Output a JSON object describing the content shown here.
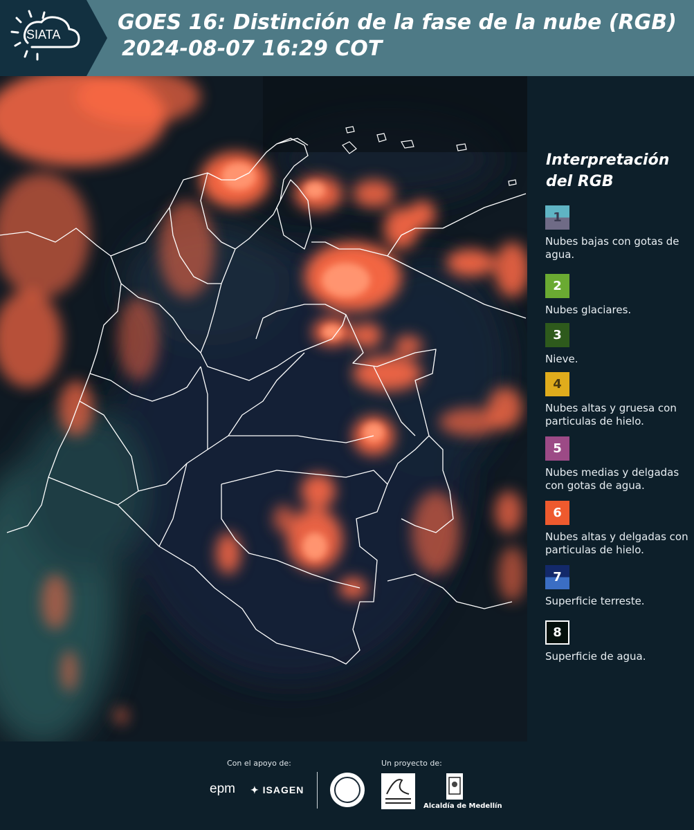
{
  "header": {
    "title_line1": "GOES 16: Distinción de la fase de la nube (RGB)",
    "title_line2": "2024-08-07 16:29 COT",
    "logo_text": "SIATA"
  },
  "colors": {
    "header_bg": "#4e7a86",
    "panel_bg": "#0d1f2a",
    "map_bg": "#101a24",
    "cloud_orange": "#ff6a45"
  },
  "legend": {
    "title": "Interpretación del RGB",
    "items": [
      {
        "num": "1",
        "label": "Nubes bajas con gotas de agua.",
        "top_color": "#5fb4c4",
        "bottom_color": "#6f6b86",
        "num_color": "#3a3a50"
      },
      {
        "num": "2",
        "label": "Nubes glaciares.",
        "top_color": "#6aaa32",
        "bottom_color": "#6aaa32",
        "num_color": "#ffffff"
      },
      {
        "num": "3",
        "label": "Nieve.",
        "top_color": "#2e5a1c",
        "bottom_color": "#2e5a1c",
        "num_color": "#ffffff"
      },
      {
        "num": "4",
        "label": "Nubes altas y gruesa con particulas de hielo.",
        "top_color": "#e0ac1c",
        "bottom_color": "#e0ac1c",
        "num_color": "#4a3a10"
      },
      {
        "num": "5",
        "label": "Nubes medias y delgadas con gotas de agua.",
        "top_color": "#9c4a86",
        "bottom_color": "#9c4a86",
        "num_color": "#ffffff"
      },
      {
        "num": "6",
        "label": "Nubes altas y delgadas con particulas de hielo.",
        "top_color": "#ee5a2e",
        "bottom_color": "#ee5a2e",
        "num_color": "#ffffff"
      },
      {
        "num": "7",
        "label": "Superficie terreste.",
        "top_color": "#13296a",
        "bottom_color": "#3b6ec4",
        "num_color": "#ffffff"
      },
      {
        "num": "8",
        "label": "Superficie de agua.",
        "top_color": "#05100c",
        "bottom_color": "#05100c",
        "num_color": "#ffffff"
      }
    ]
  },
  "footer": {
    "support_label": "Con el apoyo de:",
    "project_label": "Un proyecto de:",
    "epm": "epm",
    "isagen": "ISAGEN",
    "alcaldia": "Alcaldía de Medellín"
  }
}
